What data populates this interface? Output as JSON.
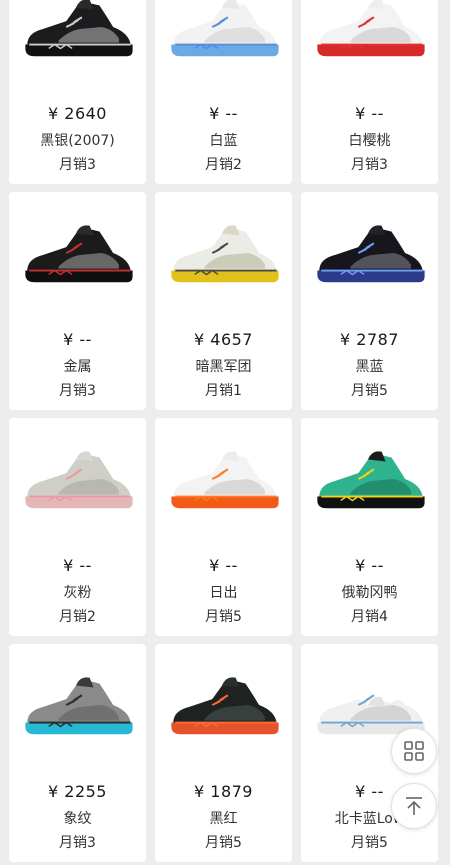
{
  "products": [
    {
      "price": "¥ 2640",
      "name": "黑银(2007)",
      "sales": "月销3",
      "shoe": "black-silver-shoe",
      "colors": {
        "upper": "#1c1c1e",
        "panel": "#7d7d80",
        "sole": "#111111",
        "accent": "#cfcfcf",
        "tongue": "#2a2a2c"
      }
    },
    {
      "price": "¥ --",
      "name": "白蓝",
      "sales": "月销2",
      "shoe": "white-blue-shoe",
      "colors": {
        "upper": "#f2f2f2",
        "panel": "#dcdcdc",
        "sole": "#6aa8e6",
        "accent": "#4f8fd8",
        "tongue": "#e8e8e8"
      }
    },
    {
      "price": "¥ --",
      "name": "白樱桃",
      "sales": "月销3",
      "shoe": "white-cherry-shoe",
      "colors": {
        "upper": "#f3f3f3",
        "panel": "#d6d6d6",
        "sole": "#d62a2a",
        "accent": "#e03030",
        "tongue": "#eeeeee"
      }
    },
    {
      "price": "¥ --",
      "name": "金属",
      "sales": "月销3",
      "shoe": "metallic-shoe",
      "colors": {
        "upper": "#1b1b1b",
        "panel": "#707070",
        "sole": "#0f0f0f",
        "accent": "#c23030",
        "tongue": "#2b2b2b"
      }
    },
    {
      "price": "¥ 4657",
      "name": "暗黑军团",
      "sales": "月销1",
      "shoe": "dark-army-shoe",
      "colors": {
        "upper": "#ecece6",
        "panel": "#c9c9b5",
        "sole": "#e2c21a",
        "accent": "#4a4a3e",
        "tongue": "#dcd6c4"
      }
    },
    {
      "price": "¥ 2787",
      "name": "黑蓝",
      "sales": "月销5",
      "shoe": "black-blue-shoe",
      "colors": {
        "upper": "#16161c",
        "panel": "#5a5a64",
        "sole": "#2c3a8a",
        "accent": "#6fa0ff",
        "tongue": "#22222a"
      }
    },
    {
      "price": "¥ --",
      "name": "灰粉",
      "sales": "月销2",
      "shoe": "grey-pink-shoe",
      "colors": {
        "upper": "#cfcfc8",
        "panel": "#b5b5ad",
        "sole": "#e5b6b6",
        "accent": "#e89aa0",
        "tongue": "#d8d8d0"
      }
    },
    {
      "price": "¥ --",
      "name": "日出",
      "sales": "月销5",
      "shoe": "sunrise-shoe",
      "colors": {
        "upper": "#f3f3f3",
        "panel": "#d5d5d5",
        "sole": "#f25a18",
        "accent": "#ff7a22",
        "tongue": "#ececec"
      }
    },
    {
      "price": "¥ --",
      "name": "俄勒冈鸭",
      "sales": "月销4",
      "shoe": "oregon-duck-shoe",
      "colors": {
        "upper": "#2fb38e",
        "panel": "#1f8a6c",
        "sole": "#111111",
        "accent": "#f0d21a",
        "tongue": "#1c1c1c"
      }
    },
    {
      "price": "¥ 2255",
      "name": "象纹",
      "sales": "月销3",
      "shoe": "elephant-print-shoe",
      "colors": {
        "upper": "#8a8a8a",
        "panel": "#6d6d6d",
        "sole": "#25b9d6",
        "accent": "#2a2a2a",
        "tongue": "#3a3a3a"
      }
    },
    {
      "price": "¥ 1879",
      "name": "黑红",
      "sales": "月销5",
      "shoe": "black-red-shoe",
      "colors": {
        "upper": "#1e2220",
        "panel": "#3c4240",
        "sole": "#e4532c",
        "accent": "#ff6a3d",
        "tongue": "#2a2e2c"
      }
    },
    {
      "price": "¥ --",
      "name": "北卡蓝Low",
      "sales": "月销5",
      "shoe": "carolina-low-shoe",
      "colors": {
        "upper": "#f0f0f0",
        "panel": "#d0d0d0",
        "sole": "#e8e8e8",
        "accent": "#6aa6d8",
        "tongue": "#e2e2e2"
      }
    }
  ],
  "floating": {
    "grid_icon": "grid-icon",
    "top_icon": "back-to-top-icon"
  }
}
